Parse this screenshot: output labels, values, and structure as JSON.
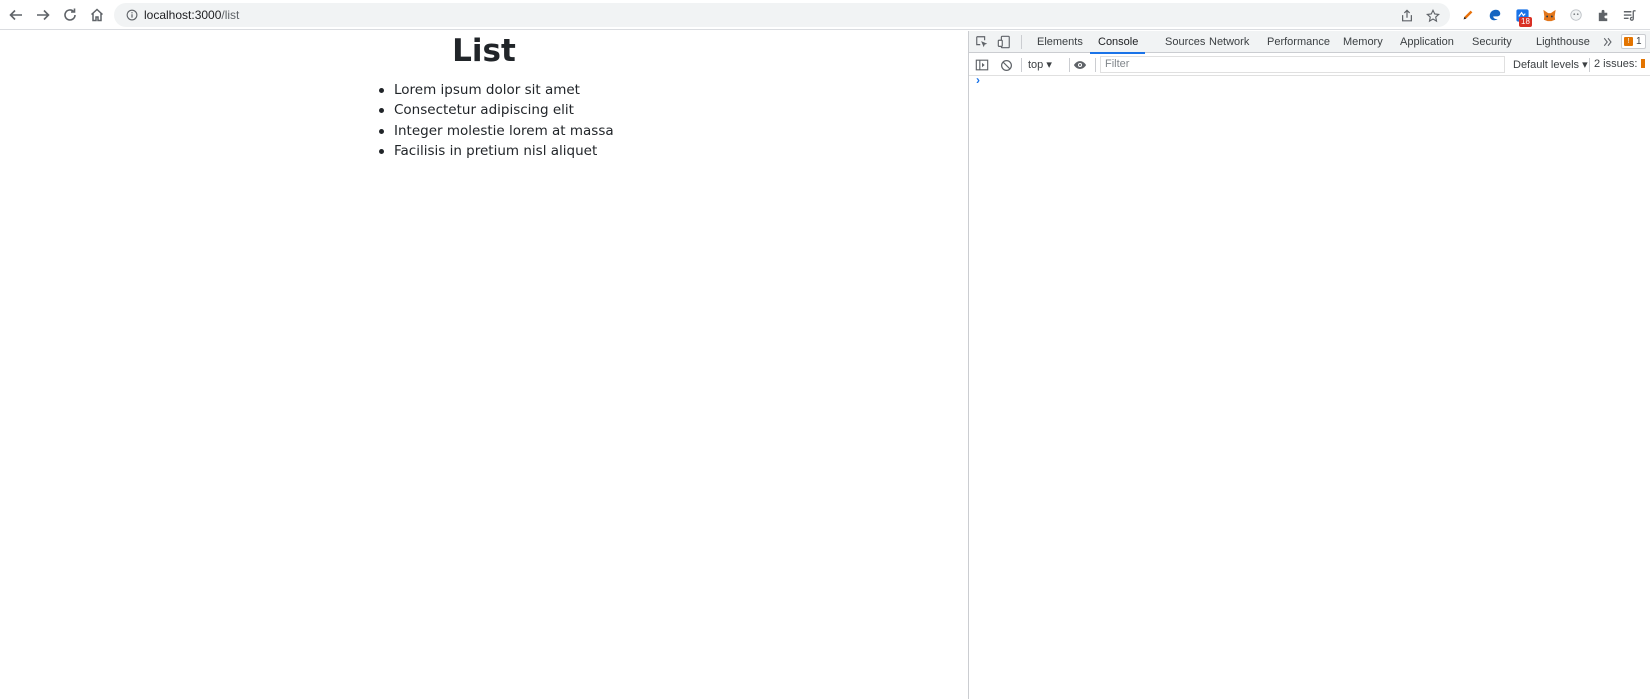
{
  "browser": {
    "url_host": "localhost:3000",
    "url_path": "/list",
    "extension_badge": "18"
  },
  "page": {
    "title": "List",
    "items": [
      "Lorem ipsum dolor sit amet",
      "Consectetur adipiscing elit",
      "Integer molestie lorem at massa",
      "Facilisis in pretium nisl aliquet"
    ]
  },
  "devtools": {
    "tabs": [
      "Elements",
      "Console",
      "Sources",
      "Network",
      "Performance",
      "Memory",
      "Application",
      "Security",
      "Lighthouse"
    ],
    "active_tab": "Console",
    "issue_count": "1",
    "context": "top",
    "filter_placeholder": "Filter",
    "levels": "Default levels",
    "issues_label": "2 issues:",
    "prompt": "›"
  },
  "colors": {
    "accent": "#1a73e8",
    "warning": "#e37400",
    "text": "#212529"
  }
}
